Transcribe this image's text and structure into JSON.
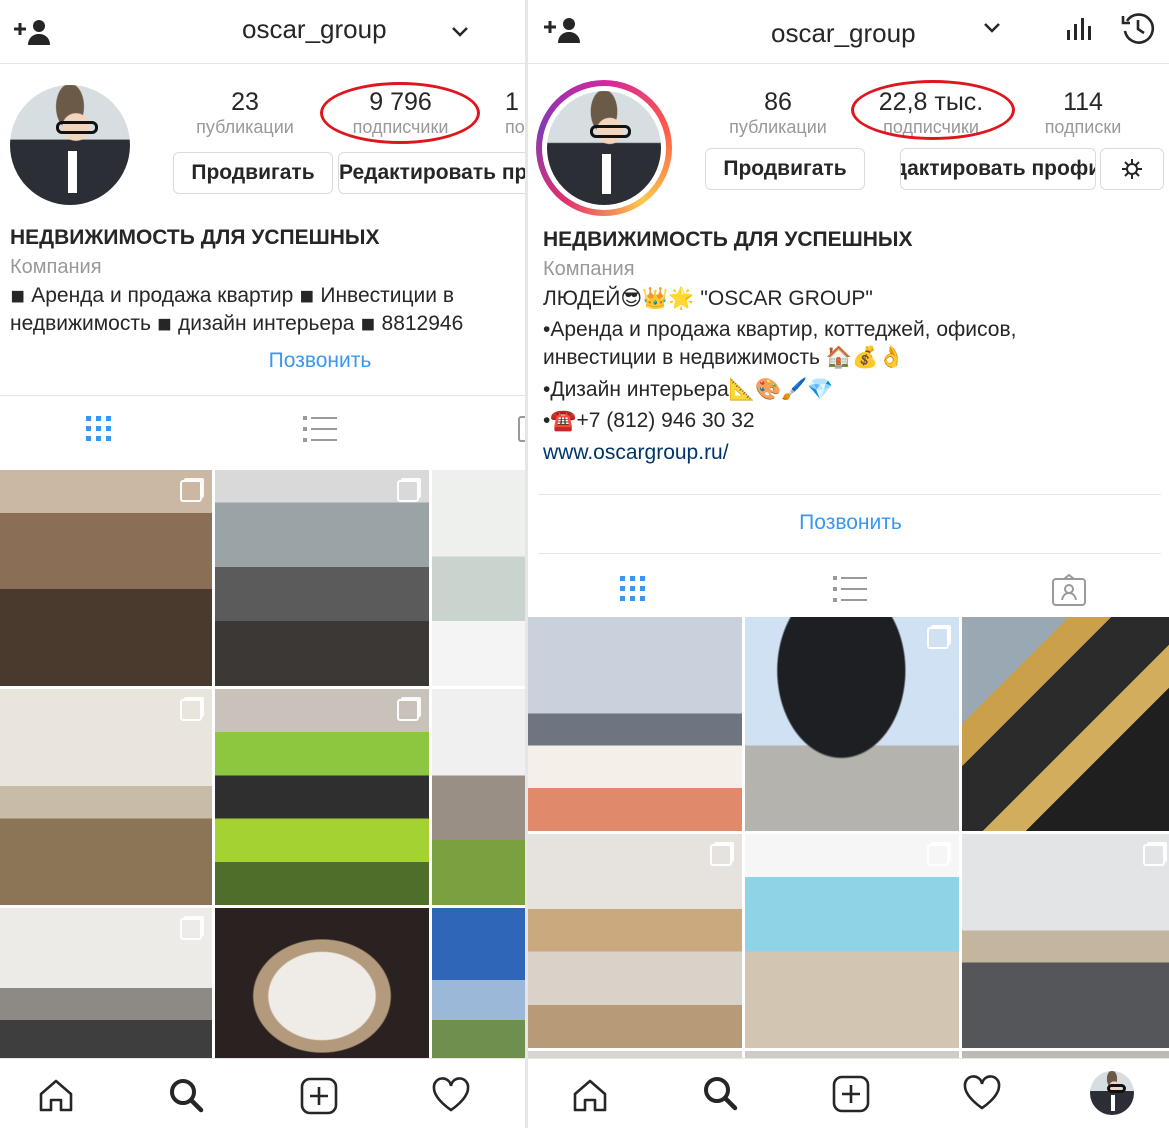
{
  "left": {
    "username": "oscar_group",
    "stats": [
      {
        "num": "23",
        "label": "публикации"
      },
      {
        "num": "9 796",
        "label": "подписчики"
      },
      {
        "num": "1",
        "label": "по"
      }
    ],
    "buttons": {
      "promote": "Продвигать",
      "edit": "Редактировать пр"
    },
    "bio": {
      "title": "НЕДВИЖИМОСТЬ ДЛЯ УСПЕШНЫХ",
      "category": "Компания",
      "lines": [
        "◾ Аренда и продажа квартир  ◾ Инвестиции в",
        "недвижимость  ◾ дизайн интерьера  ◾ 8812946"
      ]
    },
    "call": "Позвонить"
  },
  "right": {
    "username": "oscar_group",
    "stats": [
      {
        "num": "86",
        "label": "публикации"
      },
      {
        "num": "22,8 тыс.",
        "label": "подписчики"
      },
      {
        "num": "114",
        "label": "подписки"
      }
    ],
    "buttons": {
      "promote": "Продвигать",
      "edit": "Редактировать профиль"
    },
    "bio": {
      "title": "НЕДВИЖИМОСТЬ ДЛЯ УСПЕШНЫХ",
      "category": "Компания",
      "lines": [
        "ЛЮДЕЙ😎👑🌟 \"OSCAR GROUP\"",
        "•Аренда и продажа квартир, коттеджей, офисов,",
        "инвестиции в недвижимость 🏠💰👌",
        "•Дизайн интерьера📐🎨🖌️💎",
        "•☎️+7 (812) 946 30 32"
      ],
      "link": "www.oscargroup.ru/"
    },
    "call": "Позвонить"
  },
  "colors": {
    "accent": "#3897f0",
    "highlight": "#e0151e",
    "muted": "#999999",
    "text": "#262626"
  }
}
